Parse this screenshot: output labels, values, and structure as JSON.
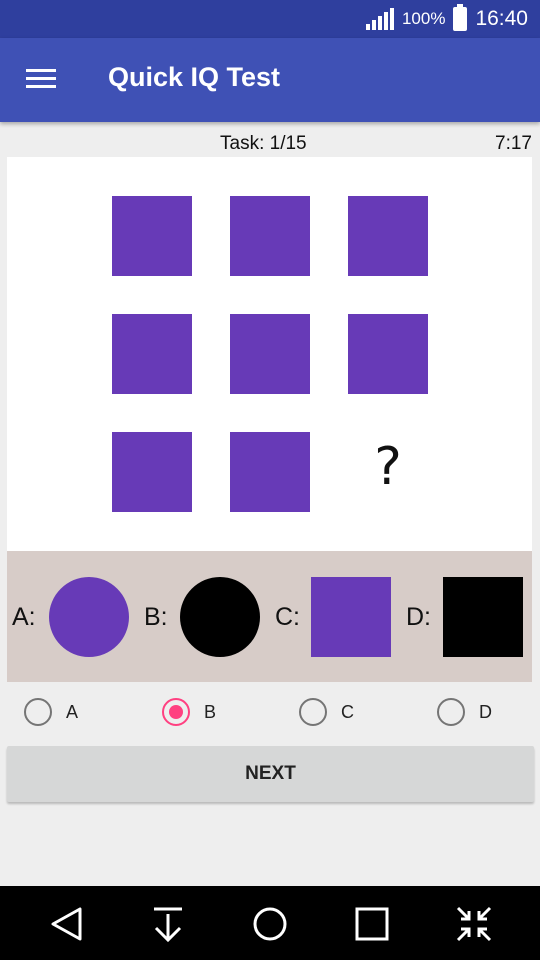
{
  "status_bar": {
    "battery": "100%",
    "time": "16:40"
  },
  "app_bar": {
    "title": "Quick IQ Test",
    "menu_icon": "hamburger-menu-icon"
  },
  "quiz": {
    "task": "Task: 1/15",
    "timer": "7:17",
    "question_mark": "?",
    "shape_color": "#673ab7",
    "option_background": "#d7ccc8",
    "options": [
      {
        "label": "A:",
        "shape": "circle",
        "color": "#673ab7"
      },
      {
        "label": "B:",
        "shape": "circle",
        "color": "#000000"
      },
      {
        "label": "C:",
        "shape": "square",
        "color": "#673ab7"
      },
      {
        "label": "D:",
        "shape": "square",
        "color": "#000000"
      }
    ],
    "answers": [
      {
        "label": "A",
        "selected": false
      },
      {
        "label": "B",
        "selected": true
      },
      {
        "label": "C",
        "selected": false
      },
      {
        "label": "D",
        "selected": false
      }
    ],
    "accent_color": "#ff4081",
    "next_label": "NEXT"
  },
  "nav_bar": {
    "icons": [
      "back-icon",
      "download-icon",
      "home-icon",
      "recents-icon",
      "collapse-icon"
    ]
  }
}
